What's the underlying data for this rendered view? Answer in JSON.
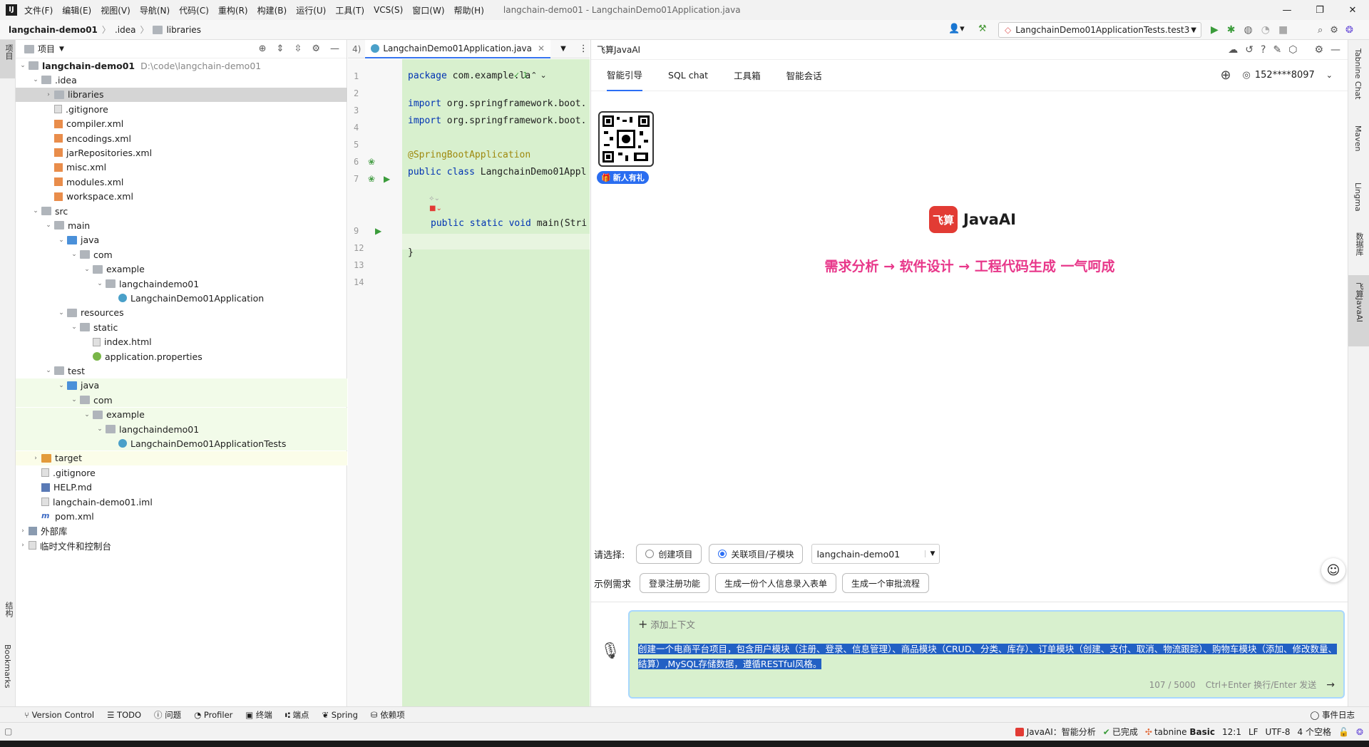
{
  "window": {
    "title": "langchain-demo01 - LangchainDemo01Application.java",
    "menu": [
      "文件(F)",
      "编辑(E)",
      "视图(V)",
      "导航(N)",
      "代码(C)",
      "重构(R)",
      "构建(B)",
      "运行(U)",
      "工具(T)",
      "VCS(S)",
      "窗口(W)",
      "帮助(H)"
    ]
  },
  "breadcrumb": [
    "langchain-demo01",
    ".idea",
    "libraries"
  ],
  "run_config": "LangchainDemo01ApplicationTests.test3",
  "project": {
    "title": "项目",
    "tree": [
      {
        "label": "langchain-demo01",
        "note": "D:\\code\\langchain-demo01"
      },
      {
        "label": ".idea"
      },
      {
        "label": "libraries"
      },
      {
        "label": ".gitignore"
      },
      {
        "label": "compiler.xml"
      },
      {
        "label": "encodings.xml"
      },
      {
        "label": "jarRepositories.xml"
      },
      {
        "label": "misc.xml"
      },
      {
        "label": "modules.xml"
      },
      {
        "label": "workspace.xml"
      },
      {
        "label": "src"
      },
      {
        "label": "main"
      },
      {
        "label": "java"
      },
      {
        "label": "com"
      },
      {
        "label": "example"
      },
      {
        "label": "langchaindemo01"
      },
      {
        "label": "LangchainDemo01Application"
      },
      {
        "label": "resources"
      },
      {
        "label": "static"
      },
      {
        "label": "index.html"
      },
      {
        "label": "application.properties"
      },
      {
        "label": "test"
      },
      {
        "label": "java"
      },
      {
        "label": "com"
      },
      {
        "label": "example"
      },
      {
        "label": "langchaindemo01"
      },
      {
        "label": "LangchainDemo01ApplicationTests"
      },
      {
        "label": "target"
      },
      {
        "label": ".gitignore"
      },
      {
        "label": "HELP.md"
      },
      {
        "label": "langchain-demo01.iml"
      },
      {
        "label": "pom.xml"
      },
      {
        "label": "外部库"
      },
      {
        "label": "临时文件和控制台"
      }
    ]
  },
  "left_stripe": {
    "project": "项目",
    "structure": "结构",
    "bookmarks": "Bookmarks"
  },
  "editor": {
    "tab_prefix": "4)",
    "tab": "LangchainDemo01Application.java",
    "inspection_count": "1",
    "line_numbers": [
      "1",
      "2",
      "3",
      "4",
      "5",
      "6",
      "7",
      "",
      "9",
      "12",
      "13",
      "14"
    ],
    "lines": {
      "l1a": "package",
      "l1b": " com.example.la",
      "l3a": "import",
      "l3b": " org.springframework.boot.",
      "l4a": "import",
      "l4b": " org.springframework.boot.",
      "l6": "@SpringBootApplication",
      "l7a": "public class",
      "l7b": " LangchainDemo01Appl",
      "l9a": "public static void",
      "l9b": " main(Stri",
      "l13": "}"
    }
  },
  "ai": {
    "title": "飞算JavaAI",
    "tabs": [
      "智能引导",
      "SQL chat",
      "工具箱",
      "智能会话"
    ],
    "user": "152****8097",
    "gift": "新人有礼",
    "brand": "JavaAI",
    "logo_text": "飞算",
    "slogan": "需求分析 → 软件设计 → 工程代码生成 一气呵成",
    "choose_label": "请选择:",
    "option_create": "创建项目",
    "option_link": "关联项目/子模块",
    "project_select": "langchain-demo01",
    "example_label": "示例需求",
    "examples": [
      "登录注册功能",
      "生成一份个人信息录入表单",
      "生成一个审批流程"
    ],
    "add_context": "添加上下文",
    "prompt": "创建一个电商平台项目，包含用户模块（注册、登录、信息管理）、商品模块（CRUD、分类、库存）、订单模块（创建、支付、取消、物流跟踪）、购物车模块（添加、修改数量、结算）,MySQL存储数据，遵循RESTful风格。",
    "counter": "107 / 5000",
    "hint": "Ctrl+Enter 换行/Enter 发送"
  },
  "right_stripe": [
    "Tabnine Chat",
    "Maven",
    "Lingma",
    "数据库",
    "飞算JavaAI"
  ],
  "bottom_tools": [
    "Version Control",
    "TODO",
    "问题",
    "Profiler",
    "终端",
    "端点",
    "Spring",
    "依赖项"
  ],
  "event_log": "事件日志",
  "status": {
    "javaai": "JavaAI：智能分析",
    "done": "已完成",
    "tabnine": "tabnine",
    "tabnine_plan": "Basic",
    "pos": "12:1",
    "lf": "LF",
    "enc": "UTF-8",
    "indent": "4 个空格"
  },
  "colors": {
    "accent": "#3574f0",
    "code_bg": "#d8f0ce",
    "slogan": "#e8378a",
    "brand_red": "#e23b34"
  }
}
